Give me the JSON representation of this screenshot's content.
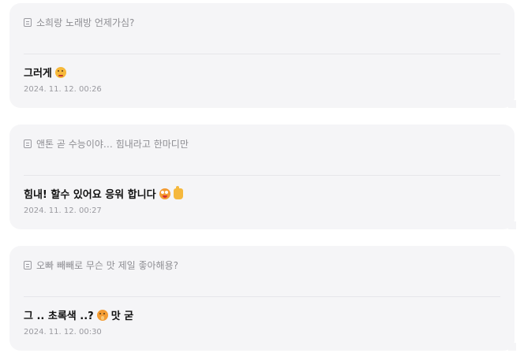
{
  "cards": [
    {
      "question": "소희랑 노래방 언제가심?",
      "answer_text": "그러게",
      "answer_emojis": [
        "thinking-face-emoji"
      ],
      "timestamp": "2024. 11. 12. 00:26"
    },
    {
      "question": "앤톤 곧 수능이야… 힘내라고 한마디만",
      "answer_text": "힘내! 할수 있어요 응워 합니다",
      "answer_emojis": [
        "goofy-face-emoji",
        "thumbs-up-emoji"
      ],
      "timestamp": "2024. 11. 12. 00:27"
    },
    {
      "question": "오빠 빼빼로 무슨 맛 제일 좋아해용?",
      "answer_text": "그 .. 초록색 ..?",
      "answer_emojis": [
        "shushing-face-emoji"
      ],
      "answer_suffix": "맛 굳",
      "timestamp": "2024. 11. 12. 00:30"
    }
  ],
  "colors": {
    "card_background": "#f5f5f7",
    "question_text": "#8e8e93",
    "answer_text": "#111111",
    "timestamp_text": "#9a9aa0",
    "divider": "#e6e6ea"
  }
}
